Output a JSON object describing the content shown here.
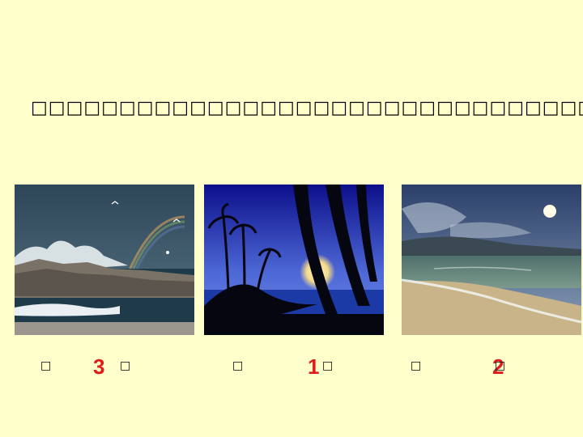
{
  "instruction": "□□□□□□□□□□□□□□□□□□□□□□□□□□□□□□□□",
  "pictures": [
    {
      "description_icon": "rough-sea-rocks-rainbow-photo",
      "left_bracket": "□",
      "answer": "3",
      "right_bracket": "□"
    },
    {
      "description_icon": "moonlit-palm-silhouette-photo",
      "left_bracket": "□",
      "answer": "1",
      "right_bracket": "□"
    },
    {
      "description_icon": "calm-beach-moon-photo",
      "left_bracket": "□",
      "answer": "2",
      "right_bracket": "□"
    }
  ],
  "colors": {
    "background": "#ffffcc",
    "answer": "#e01b1b"
  }
}
